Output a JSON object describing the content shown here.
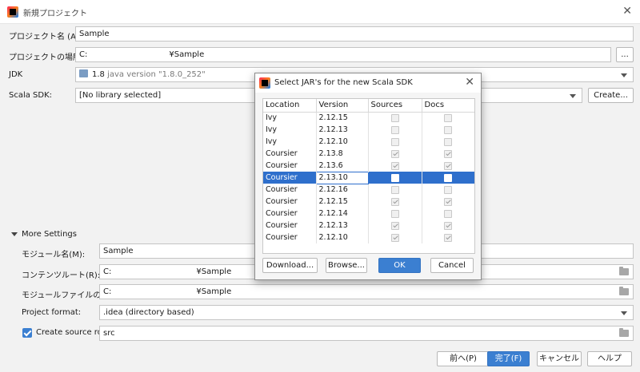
{
  "window": {
    "title": "新規プロジェクト"
  },
  "form": {
    "project_name": {
      "label": "プロジェクト名 (A):",
      "value": "Sample"
    },
    "project_location": {
      "label": "プロジェクトの場所 (L):",
      "value_start": "C:",
      "value_end": "¥Sample",
      "browse_label": "..."
    },
    "jdk": {
      "label": "JDK",
      "version": "1.8",
      "detail": "java version \"1.8.0_252\""
    },
    "scala_sdk": {
      "label": "Scala SDK:",
      "value": "[No library selected]",
      "create_label": "Create..."
    }
  },
  "more_settings": {
    "header": "More Settings",
    "module_name": {
      "label": "モジュール名(M):",
      "value": "Sample"
    },
    "content_root": {
      "label": "コンテンツルート(R):",
      "value_start": "C:",
      "value_end": "¥Sample"
    },
    "module_file_location": {
      "label": "モジュールファイルの場所(U):",
      "value_start": "C:",
      "value_end": "¥Sample"
    },
    "project_format": {
      "label": "Project format:",
      "value": ".idea (directory based)"
    },
    "create_source_root": {
      "label": "Create source root:",
      "checked": true,
      "value": "src"
    }
  },
  "footer": {
    "prev": "前へ(P)",
    "finish": "完了(F)",
    "cancel": "キャンセル",
    "help": "ヘルプ"
  },
  "dialog": {
    "title": "Select JAR's for the new Scala SDK",
    "columns": [
      "Location",
      "Version",
      "Sources",
      "Docs"
    ],
    "rows": [
      {
        "location": "Ivy",
        "version": "2.12.15",
        "sources": false,
        "docs": false
      },
      {
        "location": "Ivy",
        "version": "2.12.13",
        "sources": false,
        "docs": false
      },
      {
        "location": "Ivy",
        "version": "2.12.10",
        "sources": false,
        "docs": false
      },
      {
        "location": "Coursier",
        "version": "2.13.8",
        "sources": true,
        "docs": true
      },
      {
        "location": "Coursier",
        "version": "2.13.6",
        "sources": true,
        "docs": true
      },
      {
        "location": "Coursier",
        "version": "2.13.10",
        "sources": false,
        "docs": false,
        "selected": true
      },
      {
        "location": "Coursier",
        "version": "2.12.16",
        "sources": false,
        "docs": false
      },
      {
        "location": "Coursier",
        "version": "2.12.15",
        "sources": true,
        "docs": true
      },
      {
        "location": "Coursier",
        "version": "2.12.14",
        "sources": false,
        "docs": false
      },
      {
        "location": "Coursier",
        "version": "2.12.13",
        "sources": true,
        "docs": true
      },
      {
        "location": "Coursier",
        "version": "2.12.10",
        "sources": true,
        "docs": true
      }
    ],
    "buttons": {
      "download": "Download...",
      "browse": "Browse...",
      "ok": "OK",
      "cancel": "Cancel"
    }
  },
  "colors": {
    "accent": "#3b7fd1",
    "selection": "#2e6fcc"
  }
}
